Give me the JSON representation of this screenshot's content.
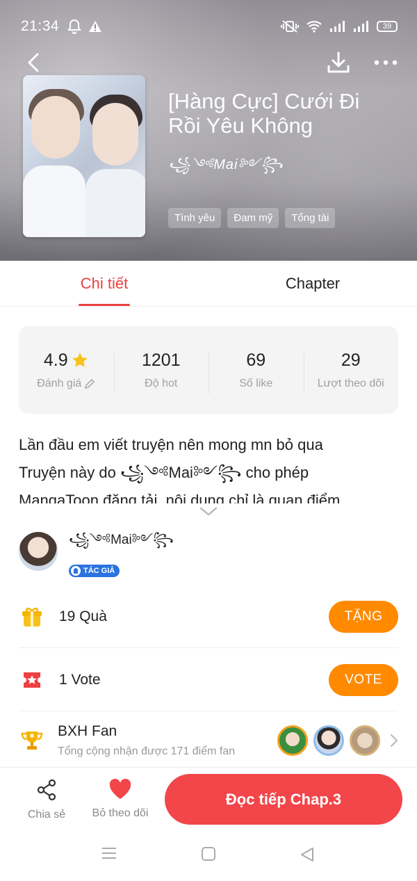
{
  "status": {
    "time": "21:34",
    "battery": "39"
  },
  "story": {
    "title": "[Hàng Cực] Cưới Đi Rồi Yêu Không",
    "author": "꧁༺Mai༻꧂",
    "tags": [
      "Tình yêu",
      "Đam mỹ",
      "Tổng tài"
    ]
  },
  "tabs": {
    "details": "Chi tiết",
    "chapter": "Chapter"
  },
  "stats": [
    {
      "value": "4.9",
      "label": "Đánh giá"
    },
    {
      "value": "1201",
      "label": "Độ hot"
    },
    {
      "value": "69",
      "label": "Số like"
    },
    {
      "value": "29",
      "label": "Lượt theo dõi"
    }
  ],
  "description": {
    "line1": "Lần đầu em viết truyện nên mong mn bỏ qua",
    "line2": "Truyện này do ꧁༺Mai༻꧂ cho phép",
    "line3": "MangaToon đăng tải, nội dung chỉ là quan điểm"
  },
  "author_row": {
    "name": "꧁༺Mai༻꧂",
    "badge": "TÁC GIẢ"
  },
  "gifts": {
    "text": "19 Quà",
    "button": "TẶNG"
  },
  "votes": {
    "text": "1 Vote",
    "button": "VOTE"
  },
  "fans": {
    "title": "BXH Fan",
    "subtitle": "Tổng cộng nhận được 171 điểm fan"
  },
  "bottom": {
    "share": "Chia sẻ",
    "unfollow": "Bỏ theo dõi",
    "read": "Đọc tiếp Chap.3"
  },
  "colors": {
    "accent": "#e8413f",
    "orange": "#ff8a00",
    "read_button": "#f2464a"
  }
}
